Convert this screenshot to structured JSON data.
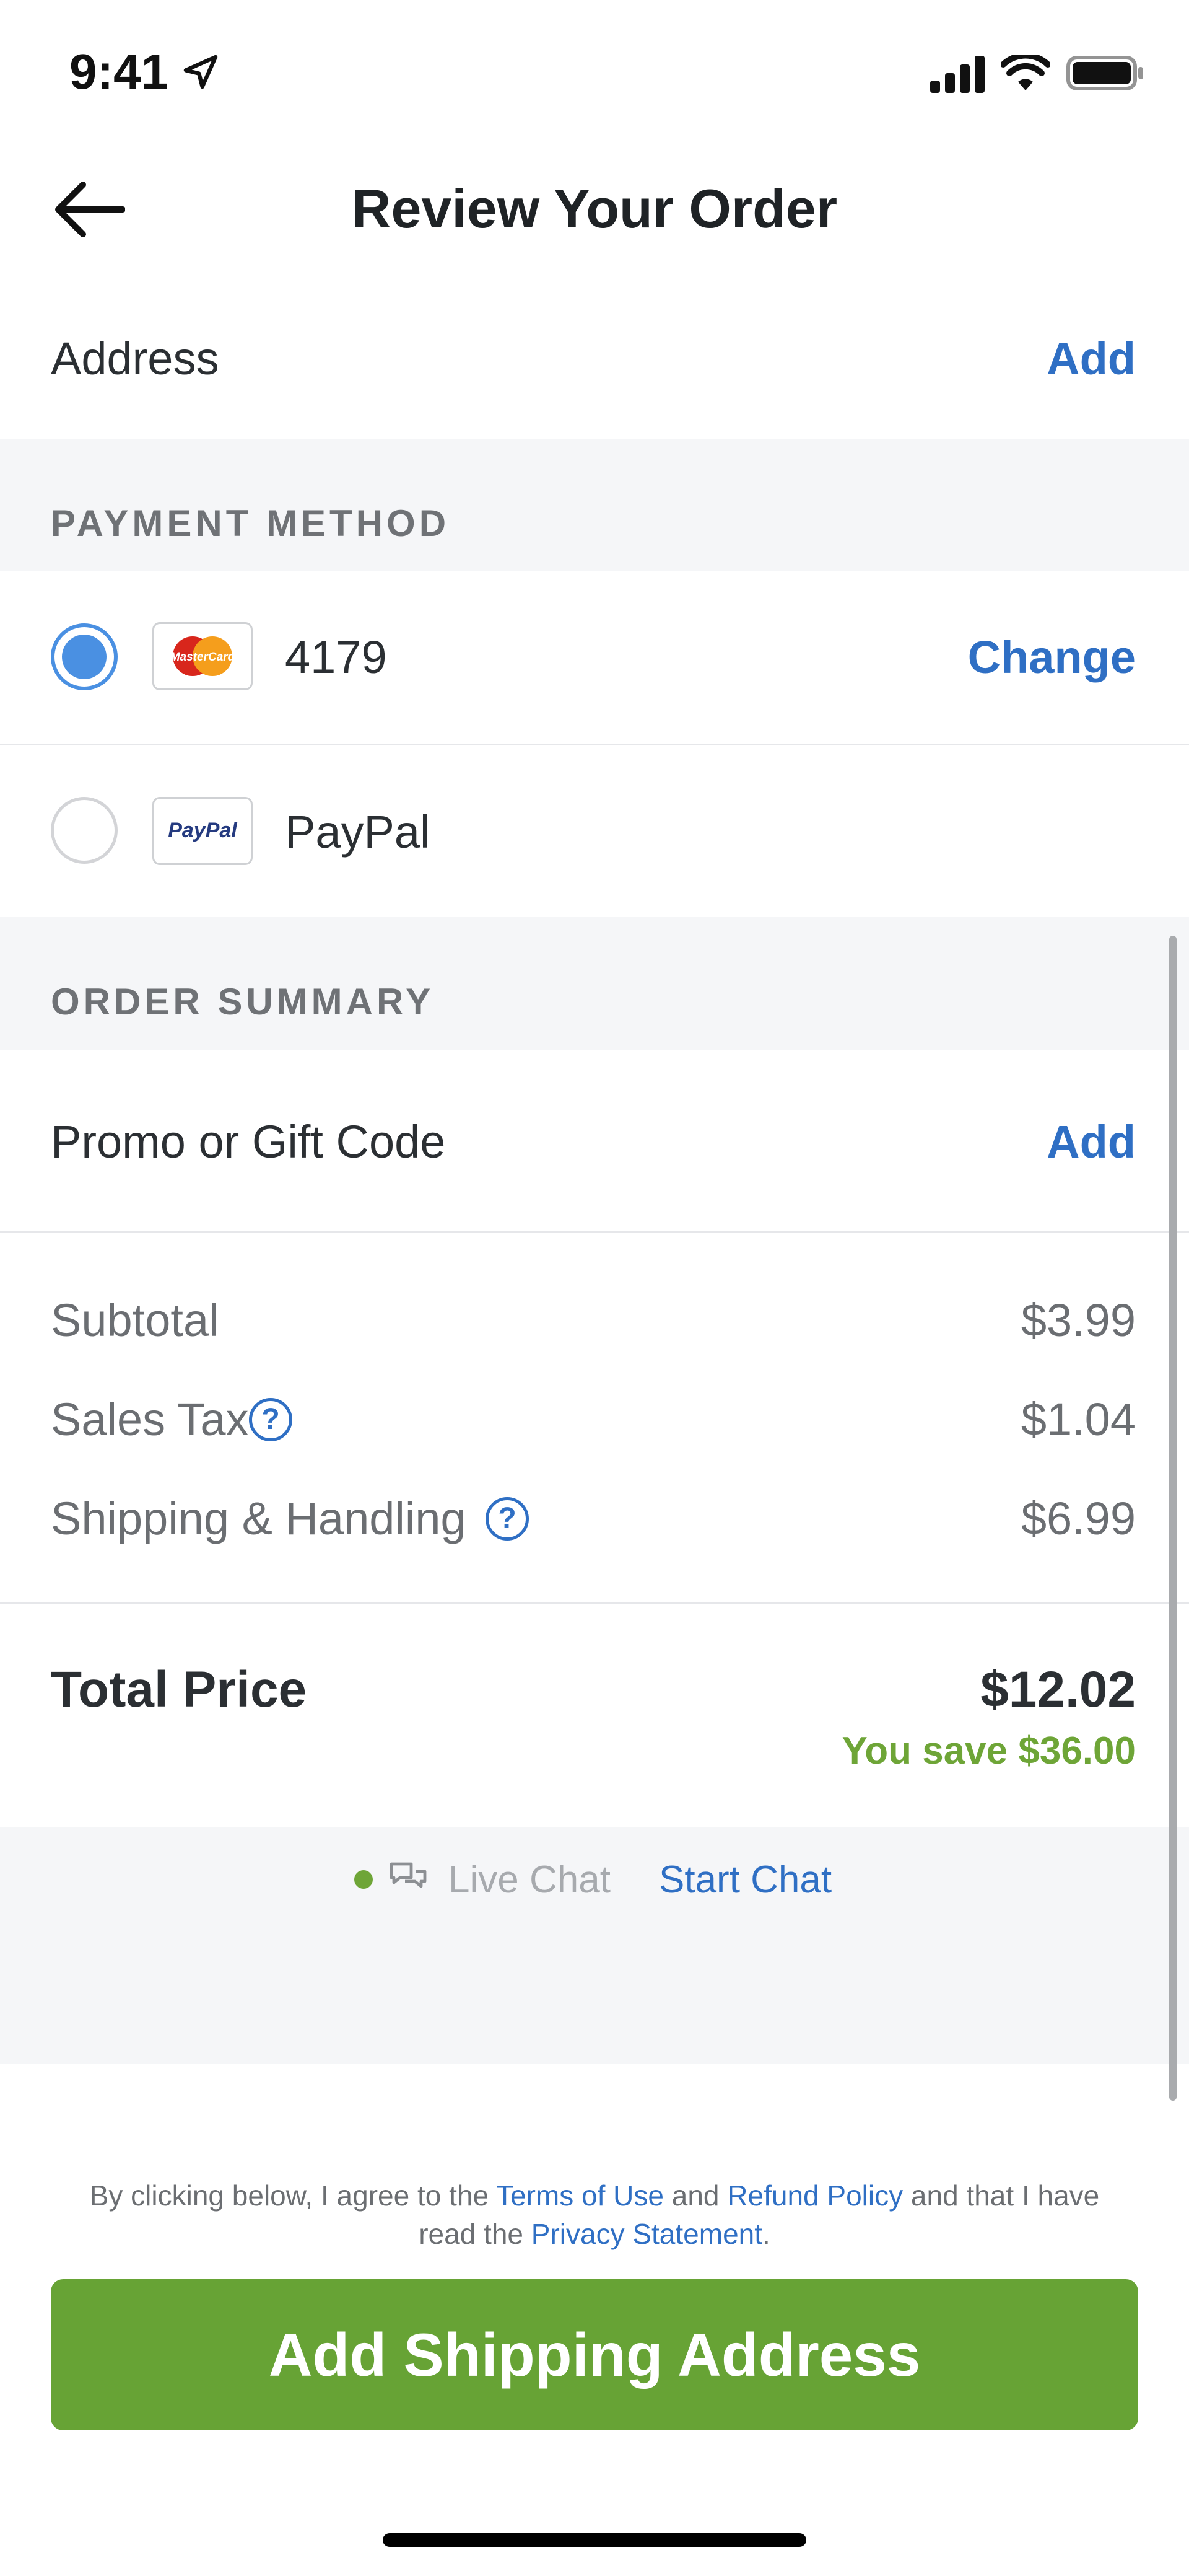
{
  "status_bar": {
    "time": "9:41"
  },
  "header": {
    "title": "Review Your Order"
  },
  "address": {
    "label": "Address",
    "action": "Add"
  },
  "payment": {
    "section_title": "PAYMENT METHOD",
    "options": [
      {
        "brand": "MasterCard",
        "label": "4179",
        "selected": true,
        "action": "Change"
      },
      {
        "brand": "PayPal",
        "label": "PayPal",
        "selected": false
      }
    ]
  },
  "order_summary": {
    "section_title": "ORDER SUMMARY",
    "promo": {
      "label": "Promo or Gift Code",
      "action": "Add"
    },
    "lines": [
      {
        "label": "Subtotal",
        "value": "$3.99",
        "help": false
      },
      {
        "label": "Sales Tax",
        "value": "$1.04",
        "help": true
      },
      {
        "label": "Shipping & Handling",
        "value": "$6.99",
        "help": true
      }
    ],
    "total": {
      "label": "Total Price",
      "value": "$12.02",
      "savings": "You save $36.00"
    }
  },
  "chat": {
    "label": "Live Chat",
    "action": "Start Chat"
  },
  "terms": {
    "part1": "By clicking below, I agree to the ",
    "terms_link": "Terms of Use",
    "part2": " and ",
    "refund_link": "Refund Policy",
    "part3": " and that I have read the ",
    "privacy_link": "Privacy Statement",
    "part4": "."
  },
  "cta": {
    "label": "Add Shipping Address"
  },
  "colors": {
    "accent": "#2f6fc4",
    "cta": "#67a335",
    "savings": "#6ea537",
    "radio": "#4a90e2"
  }
}
